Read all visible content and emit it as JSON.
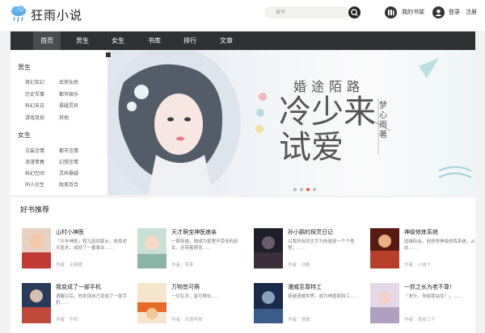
{
  "header": {
    "logo_text": "狂雨小说",
    "search_placeholder": "搜书",
    "shelf_label": "我的书架",
    "login_label": "登录",
    "register_label": "注册"
  },
  "nav": [
    "首页",
    "男生",
    "女生",
    "书库",
    "排行",
    "文章"
  ],
  "categories": {
    "male_heading": "男生",
    "male": [
      "奇幻玄幻",
      "武侠仙侠",
      "历史军事",
      "都市娱乐",
      "科幻末日",
      "悬疑灵异",
      "游戏竞技",
      "其他"
    ],
    "female_heading": "女生",
    "female": [
      "古装言情",
      "都市言情",
      "浪漫青春",
      "幻想言情",
      "科幻空间",
      "灵异悬疑",
      "同人衍生",
      "耽美百合"
    ]
  },
  "banner": {
    "top_title": "婚途陌路",
    "main_title": "冷少来试爱",
    "author": "梦心雨著"
  },
  "recommend": {
    "title": "好书推荐",
    "books": [
      {
        "title": "山村小神医",
        "desc": "「乐丰神医」程九因到家乡，依靠逆天医术，成就了一番事业……",
        "author": "作者：无痕眼"
      },
      {
        "title": "天才萌宝神医娘亲",
        "desc": "一朝穿越，她成为家里不受宠的庶女，还带着萌宝……",
        "author": "作者：某某"
      },
      {
        "title": "孙小鹂的探灵日记",
        "desc": "以我所有的文字为你驱逐一个个鬼怪，……",
        "author": "作者：孙鹂"
      },
      {
        "title": "神级修炼系统",
        "desc": "因缘际会，他获得神级修炼系统，从此……",
        "author": "作者：小城子"
      },
      {
        "title": "我变成了一部手机",
        "desc": "酒醒以后，他发现自己变成了一部手机……",
        "author": "作者：手机"
      },
      {
        "title": "万物皆可萌",
        "desc": "一切生灵，皆可萌化……",
        "author": "作者：无题阿哥"
      },
      {
        "title": "漫威至尊特工",
        "desc": "穿越漫威世界，成为神盾局特工……",
        "author": "作者：漫威"
      },
      {
        "title": "一抓之长为老不尊！",
        "desc": "「老头，你给我站住！」……",
        "author": "作者：墨染三千"
      }
    ]
  },
  "colors": {
    "nav_bg": "#303132",
    "nav_active": "#4b4c4e",
    "accent": "#e2583c"
  }
}
